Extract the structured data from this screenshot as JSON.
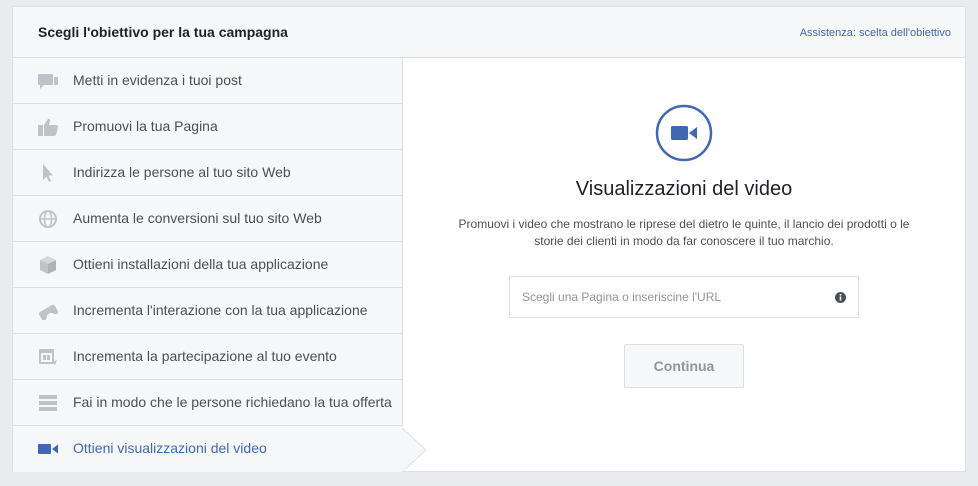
{
  "header": {
    "title": "Scegli l'obiettivo per la tua campagna",
    "help_link": "Assistenza: scelta dell'obiettivo"
  },
  "sidebar": {
    "items": [
      {
        "label": "Metti in evidenza i tuoi post",
        "icon": "post-boost-icon"
      },
      {
        "label": "Promuovi la tua Pagina",
        "icon": "thumbs-up-icon"
      },
      {
        "label": "Indirizza le persone al tuo sito Web",
        "icon": "cursor-icon"
      },
      {
        "label": "Aumenta le conversioni sul tuo sito Web",
        "icon": "globe-icon"
      },
      {
        "label": "Ottieni installazioni della tua applicazione",
        "icon": "app-box-icon"
      },
      {
        "label": "Incrementa l'interazione con la tua applicazione",
        "icon": "gamepad-icon"
      },
      {
        "label": "Incrementa la partecipazione al tuo evento",
        "icon": "calendar-icon"
      },
      {
        "label": "Fai in modo che le persone richiedano la tua offerta",
        "icon": "offer-store-icon"
      },
      {
        "label": "Ottieni visualizzazioni del video",
        "icon": "video-camera-icon",
        "selected": true
      }
    ]
  },
  "main": {
    "title": "Visualizzazioni del video",
    "description": "Promuovi i video che mostrano le riprese del dietro le quinte, il lancio dei prodotti o le storie dei clienti in modo da far conoscere il tuo marchio.",
    "input_placeholder": "Scegli una Pagina o inseriscine l'URL",
    "input_value": "",
    "continue_label": "Continua"
  },
  "colors": {
    "accent": "#4267b2",
    "icon_gray": "#bec2c9",
    "text_gray": "#4b4f56",
    "border": "#dddfe2"
  }
}
